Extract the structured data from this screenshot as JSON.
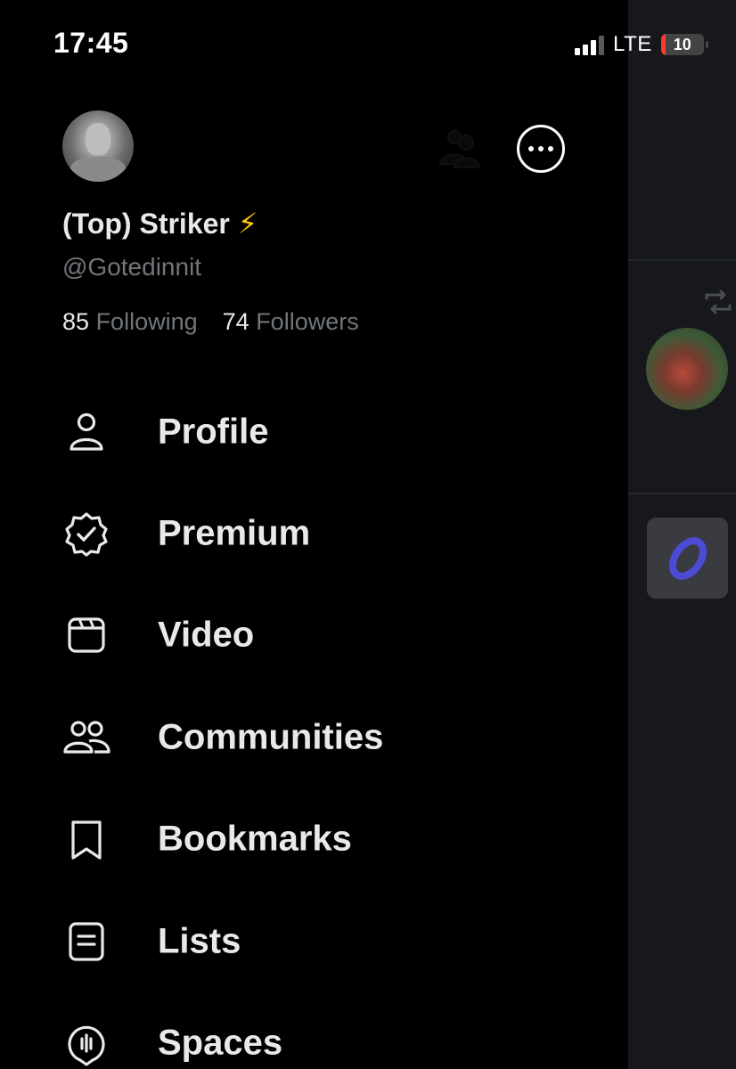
{
  "status_bar": {
    "time": "17:45",
    "network": "LTE",
    "battery_level": "10"
  },
  "profile": {
    "display_name": "(Top) Striker",
    "name_emoji": "⚡",
    "handle": "@Gotedinnit",
    "following_count": "85",
    "following_label": "Following",
    "followers_count": "74",
    "followers_label": "Followers"
  },
  "menu": [
    {
      "label": "Profile",
      "icon": "person-icon"
    },
    {
      "label": "Premium",
      "icon": "verified-badge-icon"
    },
    {
      "label": "Video",
      "icon": "video-icon"
    },
    {
      "label": "Communities",
      "icon": "communities-icon"
    },
    {
      "label": "Bookmarks",
      "icon": "bookmark-icon"
    },
    {
      "label": "Lists",
      "icon": "list-icon"
    },
    {
      "label": "Spaces",
      "icon": "spaces-icon"
    }
  ],
  "colors": {
    "background": "#000000",
    "text_primary": "#e7e9ea",
    "text_secondary": "#71767b",
    "battery_low": "#ff3b30",
    "emoji_bolt": "#ffcc00"
  }
}
